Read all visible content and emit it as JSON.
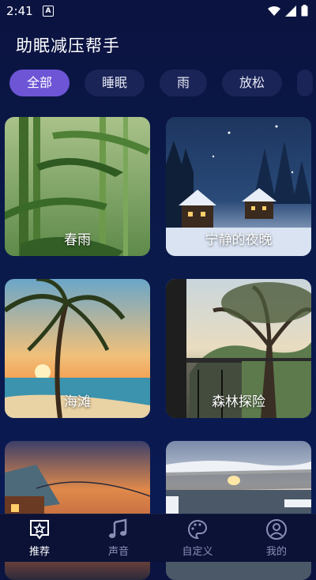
{
  "status": {
    "time": "2:41",
    "notification_letter": "A"
  },
  "header": {
    "title": "助眠减压帮手"
  },
  "categories": [
    {
      "label": "全部",
      "active": true
    },
    {
      "label": "睡眠",
      "active": false
    },
    {
      "label": "雨",
      "active": false
    },
    {
      "label": "放松",
      "active": false
    }
  ],
  "cards": [
    {
      "label": "春雨",
      "scene": "bamboo-rain"
    },
    {
      "label": "宁静的夜晚",
      "scene": "snowy-night-village"
    },
    {
      "label": "海滩",
      "scene": "beach-sunset"
    },
    {
      "label": "森林探险",
      "scene": "forest-cabin"
    },
    {
      "label": "",
      "scene": "sunset-cabin"
    },
    {
      "label": "",
      "scene": "winter-lake-sunset"
    }
  ],
  "nav": {
    "items": [
      {
        "label": "推荐",
        "icon": "star-frame-icon",
        "active": true
      },
      {
        "label": "声音",
        "icon": "music-note-icon",
        "active": false
      },
      {
        "label": "自定义",
        "icon": "palette-icon",
        "active": false
      },
      {
        "label": "我的",
        "icon": "user-icon",
        "active": false
      }
    ]
  },
  "colors": {
    "accent": "#6d55d6",
    "background": "#0a1a4a",
    "chip": "#1b2456"
  }
}
